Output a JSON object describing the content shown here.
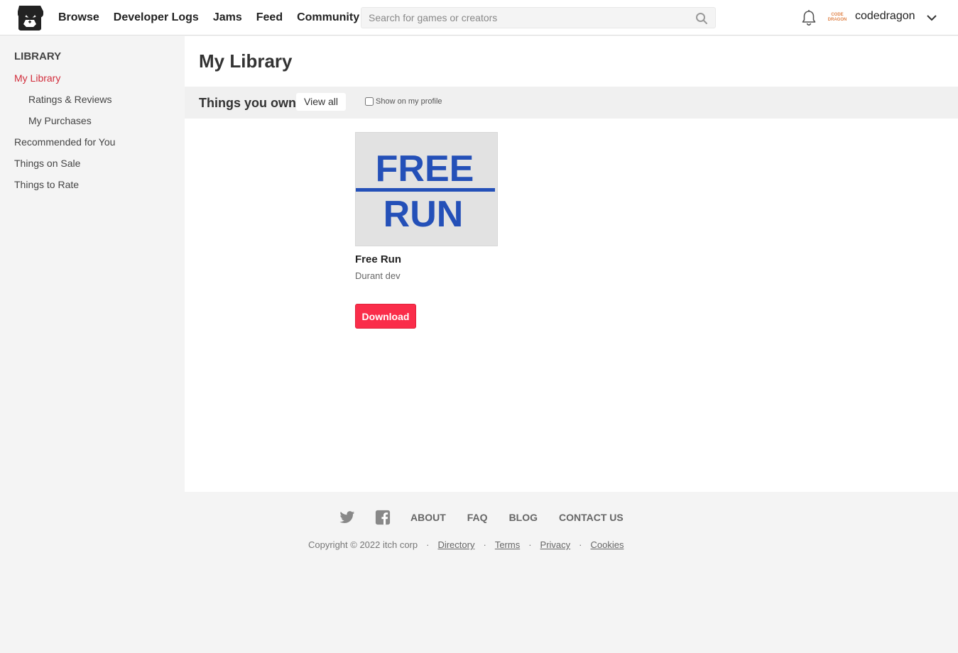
{
  "header": {
    "nav": [
      "Browse",
      "Developer Logs",
      "Jams",
      "Feed",
      "Community"
    ],
    "search_placeholder": "Search for games or creators",
    "username": "codedragon",
    "avatar_text_1": "CODE",
    "avatar_text_2": "DRAGON"
  },
  "sidebar": {
    "title": "LIBRARY",
    "items": [
      {
        "label": "My Library",
        "active": true
      },
      {
        "label": "Ratings & Reviews"
      },
      {
        "label": "My Purchases"
      },
      {
        "label": "Recommended for You"
      },
      {
        "label": "Things on Sale"
      },
      {
        "label": "Things to Rate"
      }
    ]
  },
  "main": {
    "title": "My Library",
    "section_title": "Things you own",
    "view_all": "View all",
    "show_on_profile": "Show on my profile",
    "game": {
      "thumb_line1": "FREE",
      "thumb_line2": "RUN",
      "title": "Free Run",
      "author": "Durant dev",
      "download": "Download"
    }
  },
  "footer": {
    "links": [
      "ABOUT",
      "FAQ",
      "BLOG",
      "CONTACT US"
    ],
    "copyright": "Copyright © 2022 itch corp",
    "legal": [
      "Directory",
      "Terms",
      "Privacy",
      "Cookies"
    ]
  },
  "colors": {
    "accent": "#fa2d4a",
    "active_link": "#d22d3b",
    "thumb_text": "#2450b8"
  }
}
